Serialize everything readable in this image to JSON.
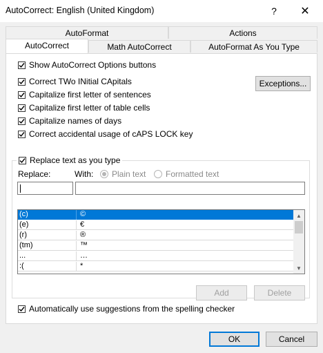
{
  "window": {
    "title": "AutoCorrect: English (United Kingdom)",
    "help_label": "?",
    "close_label": "✕"
  },
  "tabs_back": [
    {
      "label": "AutoFormat"
    },
    {
      "label": "Actions"
    }
  ],
  "tabs_front": [
    {
      "label": "AutoCorrect",
      "active": true
    },
    {
      "label": "Math AutoCorrect",
      "active": false
    },
    {
      "label": "AutoFormat As You Type",
      "active": false
    }
  ],
  "options": {
    "show_buttons": {
      "label": "Show AutoCorrect Options buttons",
      "checked": true
    },
    "correct_two_initial": {
      "label": "Correct TWo INitial CApitals",
      "checked": true
    },
    "cap_sentences": {
      "label": "Capitalize first letter of sentences",
      "checked": true
    },
    "cap_table_cells": {
      "label": "Capitalize first letter of table cells",
      "checked": true
    },
    "cap_days": {
      "label": "Capitalize names of days",
      "checked": true
    },
    "caps_lock": {
      "label": "Correct accidental usage of cAPS LOCK key",
      "checked": true
    },
    "exceptions_label": "Exceptions..."
  },
  "replace_group": {
    "replace_as_you_type": {
      "label": "Replace text as you type",
      "checked": true
    },
    "replace_label": "Replace:",
    "with_label": "With:",
    "plain_text_label": "Plain text",
    "formatted_text_label": "Formatted text",
    "replace_value": "",
    "with_value": ""
  },
  "entries": [
    {
      "from": "(c)",
      "to": "©",
      "selected": true
    },
    {
      "from": "(e)",
      "to": "€",
      "selected": false
    },
    {
      "from": "(r)",
      "to": "®",
      "selected": false
    },
    {
      "from": "(tm)",
      "to": "™",
      "selected": false
    },
    {
      "from": "...",
      "to": "…",
      "selected": false
    },
    {
      "from": ":(",
      "to": "*",
      "selected": false
    }
  ],
  "buttons": {
    "add": "Add",
    "delete": "Delete",
    "ok": "OK",
    "cancel": "Cancel"
  },
  "spelling": {
    "label": "Automatically use suggestions from the spelling checker",
    "checked": true
  },
  "colors": {
    "accent": "#0078d7",
    "selection": "#0078d7"
  }
}
